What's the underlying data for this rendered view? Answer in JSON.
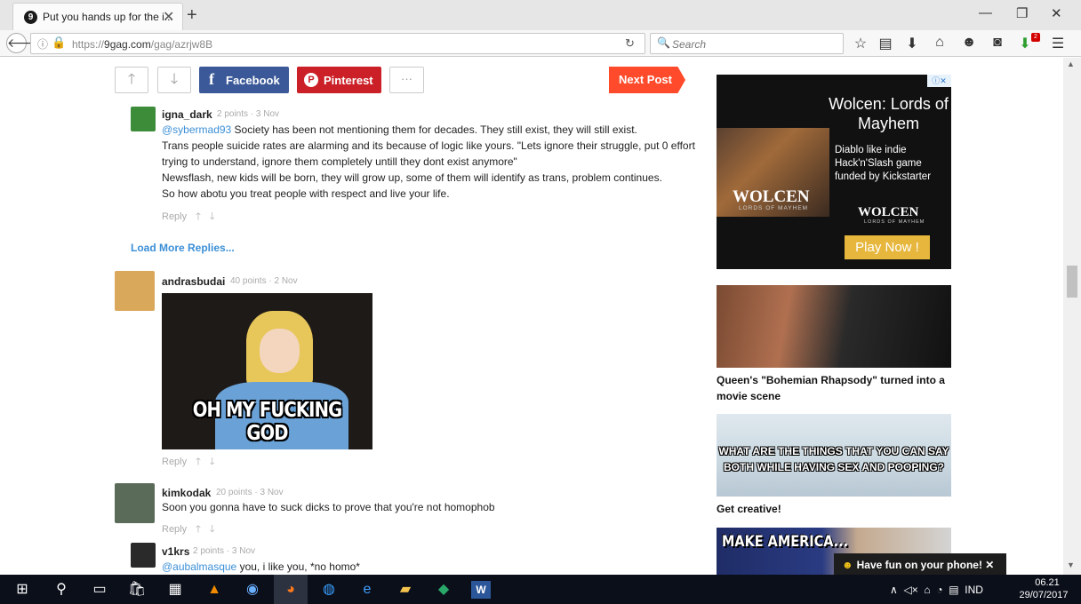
{
  "browser": {
    "tab_title": "Put you hands up for the i...",
    "tab_close": "✕",
    "new_tab": "+",
    "url_prefix": "https://",
    "url_host": "9gag.com",
    "url_path": "/gag/azrjw8B",
    "search_placeholder": "Search",
    "ext_badge": "2"
  },
  "post_actions": {
    "facebook_label": "Facebook",
    "pinterest_label": "Pinterest",
    "more_label": "···",
    "next_label": "Next Post"
  },
  "comments": [
    {
      "user": "igna_dark",
      "meta": "2 points · 3 Nov",
      "mention": "@sybermad93",
      "lines": [
        " Society has been not mentioning them for decades. They still exist, they will still exist.",
        "Trans people suicide rates are alarming and its because of logic like yours. \"Lets ignore their struggle, put 0 effort",
        "trying to understand, ignore them completely untill they dont exist anymore\"",
        "Newsflash, new kids will be born, they will grow up, some of them will identify as trans, problem continues.",
        "So how abotu you treat people with respect and live your life."
      ],
      "reply": "Reply"
    },
    {
      "user": "andrasbudai",
      "meta": "40 points · 2 Nov",
      "image_caption": "OH MY FUCKING GOD",
      "reply": "Reply"
    },
    {
      "user": "kimkodak",
      "meta": "20 points · 3 Nov",
      "text": "Soon you gonna have to suck dicks to prove that you're not homophob",
      "reply": "Reply"
    },
    {
      "user": "v1krs",
      "meta": "2 points · 3 Nov",
      "mention": "@aubalmasque",
      "text": " you, i like you, *no homo*"
    }
  ],
  "load_more": "Load More Replies...",
  "ad": {
    "title": "Wolcen: Lords of Mayhem",
    "body": "Diablo like indie Hack'n'Slash game funded by Kickstarter",
    "logo": "WOLCEN",
    "logo_sub": "LORDS OF MAYHEM",
    "cta": "Play Now !",
    "choices": "ⓘ✕"
  },
  "sidebar_posts": [
    {
      "title": "Queen's \"Bohemian Rhapsody\" turned into a movie scene"
    },
    {
      "caption": "WHAT ARE THE THINGS THAT YOU CAN SAY BOTH WHILE HAVING SEX AND POOPING?",
      "title": "Get creative!"
    },
    {
      "caption": "MAKE AMERICA..."
    }
  ],
  "toast": "Have fun on your phone! ✕",
  "taskbar": {
    "lang": "IND",
    "time": "06.21",
    "date": "29/07/2017"
  },
  "colors": {
    "facebook": "#3b5998",
    "pinterest": "#cb2027",
    "next_post": "#ff4b2b",
    "link": "#3b8fd6"
  }
}
